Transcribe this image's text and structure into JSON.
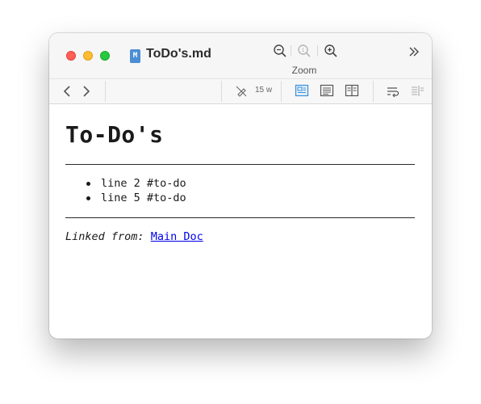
{
  "window": {
    "title": "ToDo's.md",
    "doc_icon_glyph": "M"
  },
  "toolbar": {
    "zoom_label": "Zoom",
    "word_count": "15 w"
  },
  "document": {
    "heading": "To-Do's",
    "items": [
      {
        "text": "line 2 #to-do"
      },
      {
        "text": "line 5 #to-do"
      }
    ],
    "linked_from_label": "Linked from:",
    "linked_from_link": "Main Doc"
  },
  "colors": {
    "accent": "#3a8fd6",
    "link": "#0000ee",
    "doc_icon": "#4a8fd4"
  }
}
